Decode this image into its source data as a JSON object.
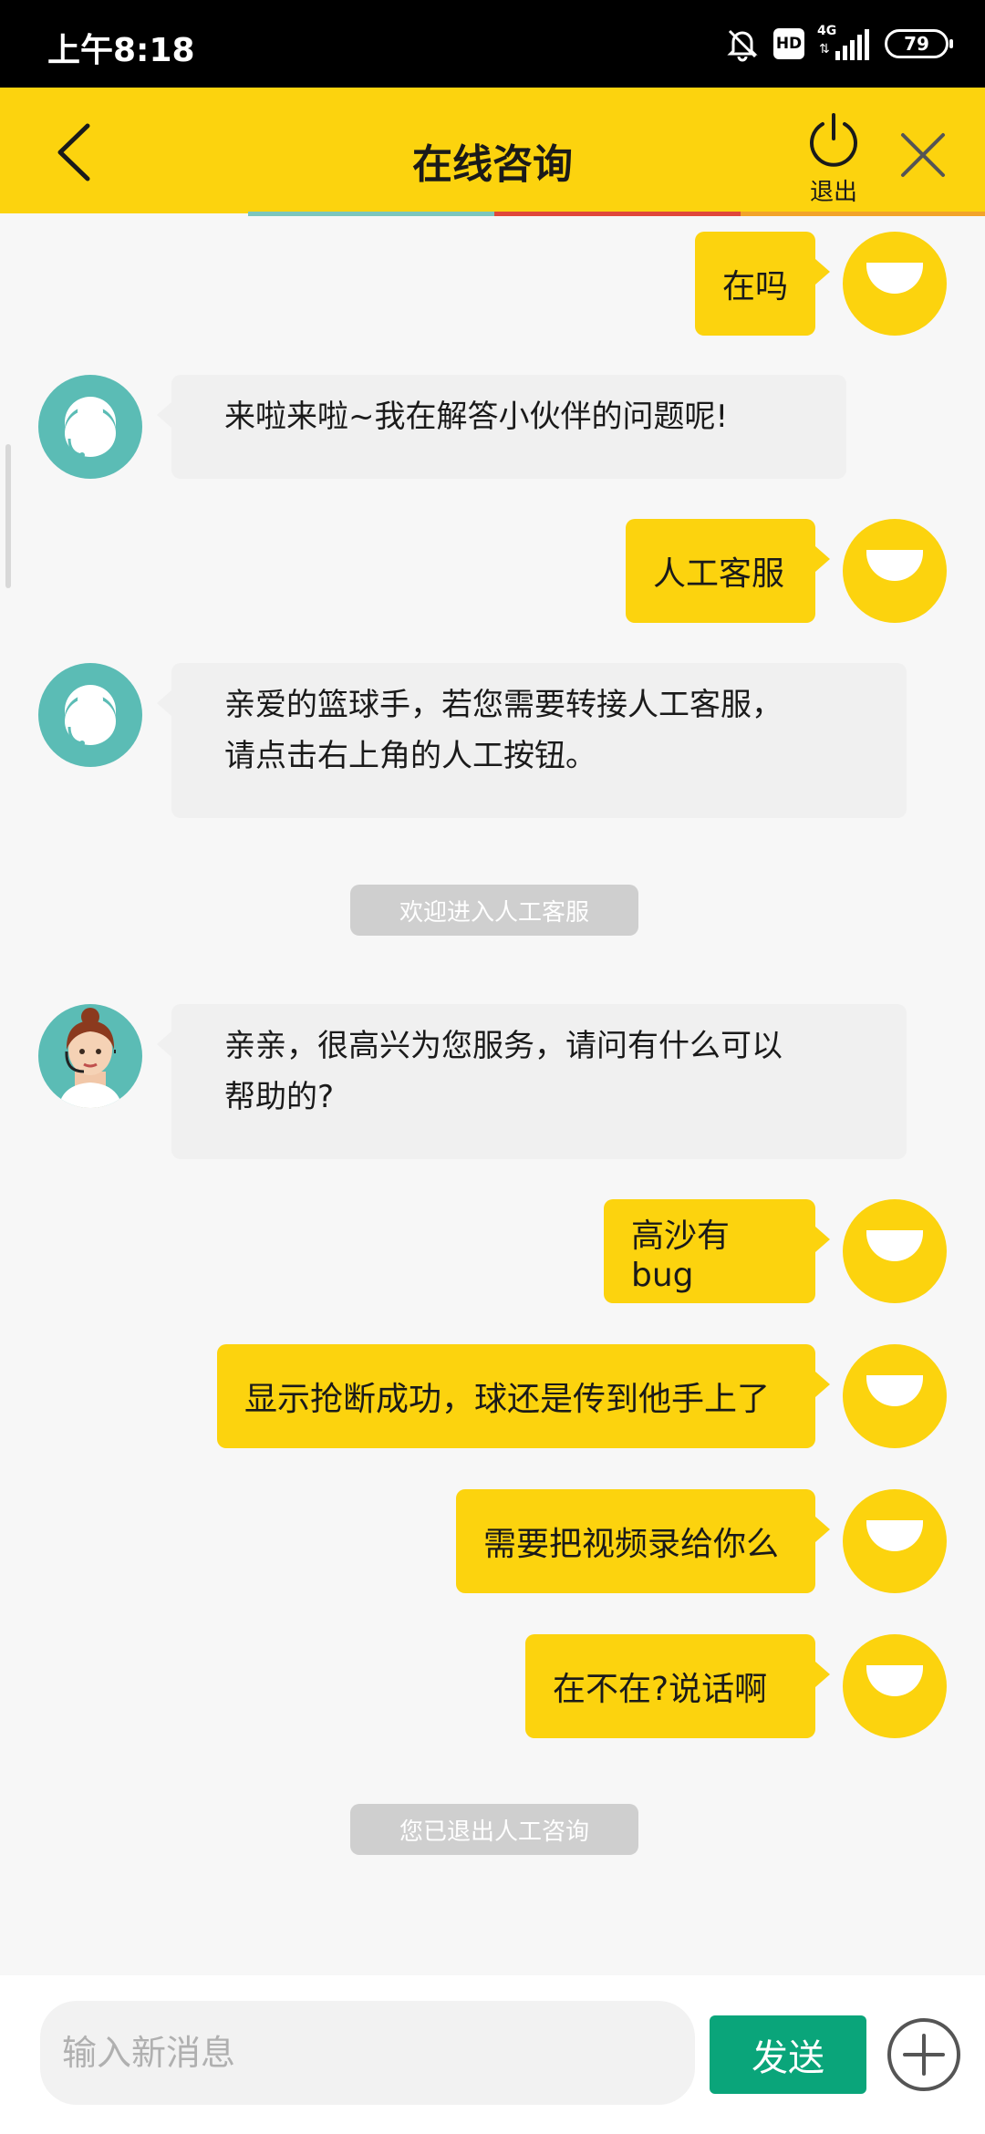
{
  "status_bar": {
    "time": "上午8:18",
    "hd_label": "HD",
    "network_label": "4G",
    "battery": "79"
  },
  "header": {
    "title": "在线咨询",
    "logout_label": "退出",
    "accent_color": "#fcd30e"
  },
  "messages": [
    {
      "side": "user",
      "text": "在吗"
    },
    {
      "side": "bot",
      "text": "来啦来啦~我在解答小伙伴的问题呢!"
    },
    {
      "side": "user",
      "text": "人工客服"
    },
    {
      "side": "bot",
      "lines": [
        "亲爱的篮球手，若您需要转接人工客服，",
        "请点击右上角的人工按钮。"
      ]
    },
    {
      "side": "system",
      "text": "欢迎进入人工客服"
    },
    {
      "side": "agent",
      "lines": [
        "亲亲，很高兴为您服务，请问有什么可以",
        "帮助的?"
      ]
    },
    {
      "side": "user",
      "text": "高沙有bug"
    },
    {
      "side": "user",
      "text": "显示抢断成功，球还是传到他手上了"
    },
    {
      "side": "user",
      "text": "需要把视频录给你么"
    },
    {
      "side": "user",
      "text": "在不在?说话啊"
    },
    {
      "side": "system",
      "text": "您已退出人工咨询"
    }
  ],
  "composer": {
    "placeholder": "输入新消息",
    "send_label": "发送"
  },
  "colors": {
    "user_bubble": "#fcd30e",
    "bot_bubble": "#f0f0f0",
    "avatar_teal": "#5bbcb5",
    "send_button": "#0aa57a"
  },
  "icons": [
    "back-arrow-icon",
    "power-icon",
    "close-icon",
    "plus-circle-icon",
    "mute-bell-icon",
    "signal-icon",
    "battery-icon"
  ]
}
